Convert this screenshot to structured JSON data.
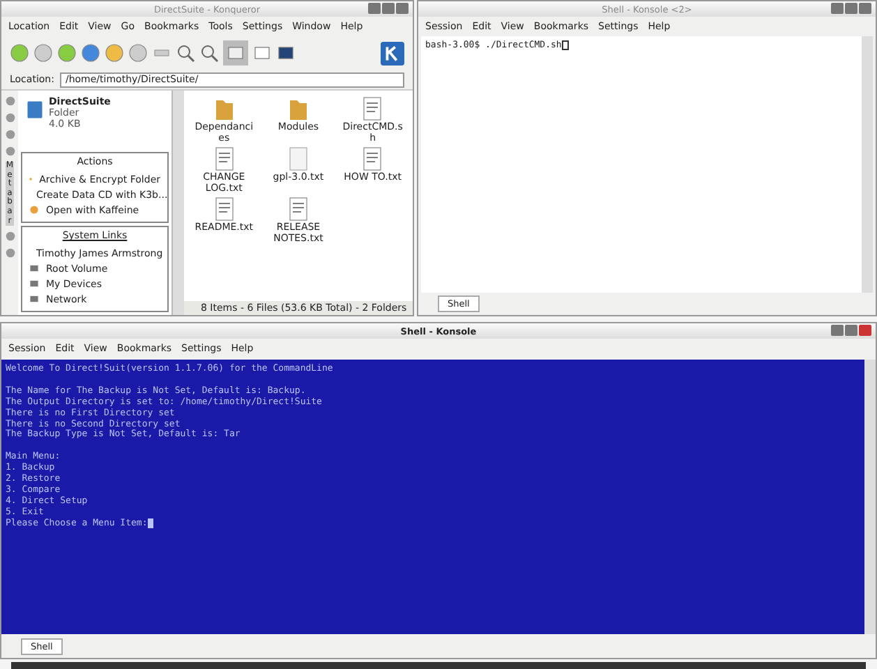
{
  "konqueror": {
    "title": "DirectSuite - Konqueror",
    "menu": [
      "Location",
      "Edit",
      "View",
      "Go",
      "Bookmarks",
      "Tools",
      "Settings",
      "Window",
      "Help"
    ],
    "location_label": "Location:",
    "location": "/home/timothy/DirectSuite/",
    "sidebar_tab": "Metabar",
    "folder": {
      "name": "DirectSuite",
      "type": "Folder",
      "size": "4.0 KB"
    },
    "actions_title": "Actions",
    "actions": [
      "Archive & Encrypt Folder",
      "Create Data CD with K3b...",
      "Open with Kaffeine"
    ],
    "links_title": "System Links",
    "links": [
      "Timothy James Armstrong",
      "Root Volume",
      "My Devices",
      "Network"
    ],
    "files": [
      {
        "name": "Dependancies",
        "kind": "folder"
      },
      {
        "name": "Modules",
        "kind": "folder"
      },
      {
        "name": "DirectCMD.sh",
        "kind": "document"
      },
      {
        "name": "CHANGE LOG.txt",
        "kind": "document"
      },
      {
        "name": "gpl-3.0.txt",
        "kind": "blank"
      },
      {
        "name": "HOW TO.txt",
        "kind": "document"
      },
      {
        "name": "README.txt",
        "kind": "document"
      },
      {
        "name": "RELEASE NOTES.txt",
        "kind": "document"
      }
    ],
    "status": "8 Items - 6 Files (53.6 KB Total) - 2 Folders"
  },
  "small_konsole": {
    "title": "Shell - Konsole <2>",
    "menu": [
      "Session",
      "Edit",
      "View",
      "Bookmarks",
      "Settings",
      "Help"
    ],
    "paragraphs": [
      [
        "bash-3.00$ ./DirectCMD.sh"
      ]
    ],
    "tab": "Shell"
  },
  "konsole": {
    "title": "Shell - Konsole",
    "menu": [
      "Session",
      "Edit",
      "View",
      "Bookmarks",
      "Settings",
      "Help"
    ],
    "paragraphs": [
      [
        "Welcome To Direct!Suit(version 1.1.7.06) for the CommandLine"
      ],
      [
        "The Name for The Backup is Not Set, Default is: Backup.",
        "The Output Directory is set to: /home/timothy/Direct!Suite",
        "There is no First Directory set",
        "There is no Second Directory set",
        "The Backup Type is Not Set, Default is: Tar"
      ],
      [
        "Main Menu:",
        "1. Backup",
        "2. Restore",
        "3. Compare",
        "4. Direct Setup",
        "5. Exit",
        "Please Choose a Menu Item:"
      ]
    ],
    "tab": "Shell"
  }
}
